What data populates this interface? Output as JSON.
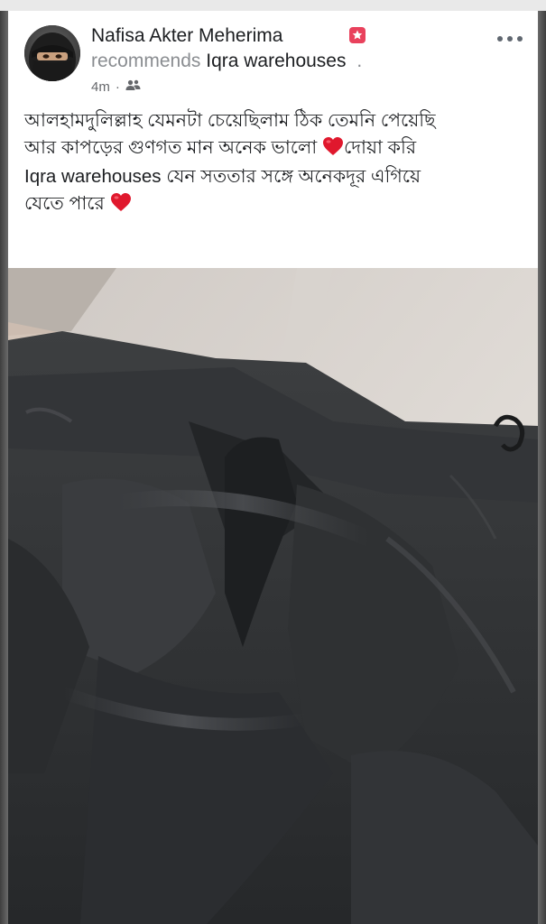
{
  "post": {
    "author": "Nafisa Akter Meherima",
    "recommends_verb": "recommends",
    "page_name": "Iqra warehouses",
    "trailing_dot": ".",
    "time": "4m",
    "separator": "·",
    "privacy_icon": "friends-icon",
    "badge_icon": "new-member-badge-icon",
    "body_lines": [
      "আলহামদুলিল্লাহ যেমনটা চেয়েছিলাম ঠিক তেমনি পেয়েছি",
      "আর কাপড়ের গুণগত মান অনেক ভালো",
      "দোয়া করি",
      "Iqra warehouses যেন সততার সঙ্গে অনেকদূর এগিয়ে",
      "যেতে পারে"
    ],
    "more_icon": "more-options-icon",
    "heart_color": "#e0182d",
    "photo_subject": "black-abaya-photo"
  },
  "colors": {
    "card_bg": "#ffffff",
    "name_text": "#1c1e21",
    "secondary_text": "#8a8d91",
    "badge": "#e9415c"
  }
}
